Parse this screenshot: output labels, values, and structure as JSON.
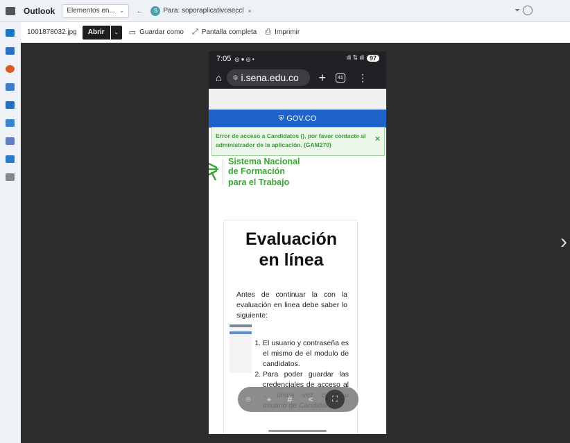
{
  "outlook": {
    "app_title": "Outlook",
    "tab_folder": "Elementos en...",
    "tab_folder_chevron": "⌄",
    "back_arrow": "←",
    "avatar_letter": "S",
    "tab_message": "Para: soporaplicativoseccl",
    "tab_close": "×",
    "filter_icon": "⏷"
  },
  "viewer": {
    "filename": "1001878032.jpg",
    "open_label": "Abrir",
    "open_chevron": "⌄",
    "save_as_label": "Guardar como",
    "fullscreen_label": "Pantalla completa",
    "print_label": "Imprimir",
    "next_arrow": "›"
  },
  "phone": {
    "time": "7:05",
    "status_icons": "◎ ● ◎ •",
    "signal": "ıll ⇅ ıll",
    "battery": "97",
    "home_icon": "⌂",
    "url_lock": "⚙",
    "url_text": "i.sena.edu.co",
    "plus": "+",
    "tab_count": "41",
    "menu": "⋮",
    "gov_shield": "⛨",
    "gov_text": "GOV.CO",
    "error_message": "Error de acceso a Candidatos (), por favor contacte al administrador de la aplicación. (GAM270)",
    "error_close": "×",
    "sena_line1": "Sistema Nacional",
    "sena_line2": "de Formación",
    "sena_line3": "para el Trabajo",
    "card_title_line1": "Evaluación",
    "card_title_line2": "en línea",
    "card_intro": "Antes de continuar la con la evaluación en linea debe saber lo siguiente:",
    "list_item_1": "El usuario y contraseña es el mismo de el modulo de candidatos.",
    "list_item_2": "Para poder guardar las credenciales de acceso al ... única vez con su usuario de Candidato ...",
    "toolbar_icons": [
      "⌾",
      "⌖",
      "#",
      "<",
      "⛶"
    ]
  },
  "colors": {
    "gov_blue": "#1e63c9",
    "sena_green": "#3aa535",
    "error_bg": "#e9f6e8",
    "viewer_bg": "#2d2d2d"
  }
}
